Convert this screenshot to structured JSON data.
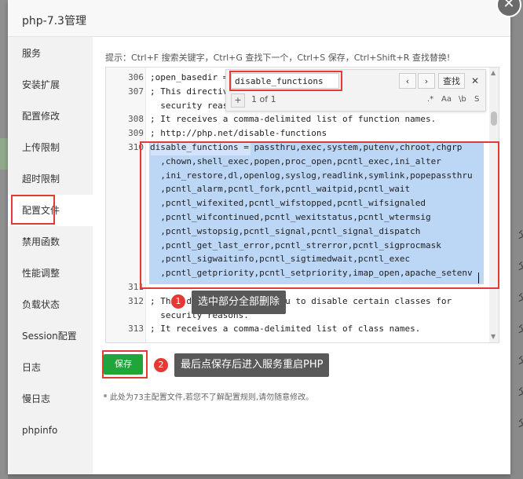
{
  "dialog": {
    "title": "php-7.3管理",
    "close_label": "✕"
  },
  "sidebar": {
    "items": [
      {
        "label": "服务"
      },
      {
        "label": "安装扩展"
      },
      {
        "label": "配置修改"
      },
      {
        "label": "上传限制"
      },
      {
        "label": "超时限制"
      },
      {
        "label": "配置文件"
      },
      {
        "label": "禁用函数"
      },
      {
        "label": "性能调整"
      },
      {
        "label": "负载状态"
      },
      {
        "label": "Session配置"
      },
      {
        "label": "日志"
      },
      {
        "label": "慢日志"
      },
      {
        "label": "phpinfo"
      }
    ],
    "active_index": 5
  },
  "content": {
    "tip": "提示：Ctrl+F 搜索关键字，Ctrl+G 查找下一个，Ctrl+S 保存，Ctrl+Shift+R 查找替换!"
  },
  "editor": {
    "lines": [
      {
        "num": "306",
        "text": ";open_basedir ="
      },
      {
        "num": "307",
        "text": "; This directive allows you to disable certain functions for"
      },
      {
        "num": "",
        "text": "  security reasons."
      },
      {
        "num": "308",
        "text": "; It receives a comma-delimited list of function names."
      },
      {
        "num": "309",
        "text": "; http://php.net/disable-functions"
      },
      {
        "num": "310",
        "text": "disable_functions = passthru,exec,system,putenv,chroot,chgrp"
      },
      {
        "num": "",
        "text": "  ,chown,shell_exec,popen,proc_open,pcntl_exec,ini_alter"
      },
      {
        "num": "",
        "text": "  ,ini_restore,dl,openlog,syslog,readlink,symlink,popepassthru"
      },
      {
        "num": "",
        "text": "  ,pcntl_alarm,pcntl_fork,pcntl_waitpid,pcntl_wait"
      },
      {
        "num": "",
        "text": "  ,pcntl_wifexited,pcntl_wifstopped,pcntl_wifsignaled"
      },
      {
        "num": "",
        "text": "  ,pcntl_wifcontinued,pcntl_wexitstatus,pcntl_wtermsig"
      },
      {
        "num": "",
        "text": "  ,pcntl_wstopsig,pcntl_signal,pcntl_signal_dispatch"
      },
      {
        "num": "",
        "text": "  ,pcntl_get_last_error,pcntl_strerror,pcntl_sigprocmask"
      },
      {
        "num": "",
        "text": "  ,pcntl_sigwaitinfo,pcntl_sigtimedwait,pcntl_exec"
      },
      {
        "num": "",
        "text": "  ,pcntl_getpriority,pcntl_setpriority,imap_open,apache_setenv"
      },
      {
        "num": "311",
        "text": ""
      },
      {
        "num": "312",
        "text": "; This directive allows you to disable certain classes for"
      },
      {
        "num": "",
        "text": "  security reasons."
      },
      {
        "num": "313",
        "text": "; It receives a comma-delimited list of class names."
      }
    ]
  },
  "find": {
    "query": "disable_functions",
    "prev": "‹",
    "next": "›",
    "search_label": "查找",
    "close": "✕",
    "plus": "+",
    "count": "1 of 1",
    "opt_regex": ".*",
    "opt_case": "Aa",
    "opt_word": "\\b",
    "opt_sel": "S"
  },
  "actions": {
    "save_label": "保存"
  },
  "note": "此处为73主配置文件,若您不了解配置规则,请勿随意修改。",
  "annotations": [
    {
      "number": "1",
      "text": "选中部分全部删除"
    },
    {
      "number": "2",
      "text": "最后点保存后进入服务重启PHP"
    }
  ],
  "backdrop": {
    "right_glyph": "父"
  },
  "colors": {
    "accent": "#20a53a",
    "highlight": "#e53935",
    "selection": "#bcd6f6"
  }
}
